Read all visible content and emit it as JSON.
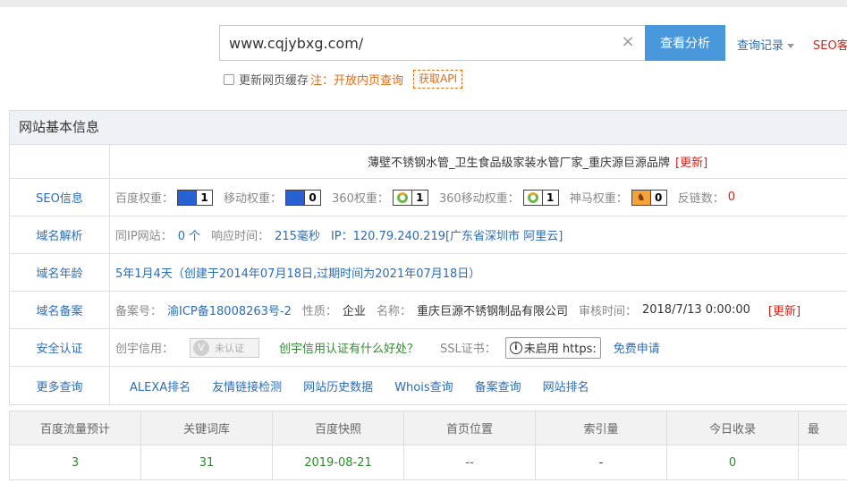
{
  "search": {
    "value": "www.cqjybxg.com/",
    "button": "查看分析",
    "history": "查询记录",
    "seo_link": "SEO客"
  },
  "cache": {
    "label": "更新网页缓存",
    "note": "注：开放内页查询",
    "api_button": "获取API"
  },
  "panel": {
    "title": "网站基本信息",
    "site_title": "薄壁不锈钢水管_卫生食品级家装水管厂家_重庆源巨源品牌",
    "site_title_update": "[更新]",
    "seo": {
      "label": "SEO信息",
      "baidu_label": "百度权重：",
      "baidu_val": "1",
      "mobile_label": "移动权重：",
      "mobile_val": "0",
      "s360_label": "360权重：",
      "s360_val": "1",
      "s360m_label": "360移动权重：",
      "s360m_val": "1",
      "shenma_label": "神马权重：",
      "shenma_val": "0",
      "backlinks_label": "反链数：",
      "backlinks_val": "0"
    },
    "dns": {
      "label": "域名解析",
      "sameip_label": "同IP网站：",
      "sameip_val": "0 个",
      "resp_label": "响应时间：",
      "resp_val": "215毫秒",
      "ip_text": "IP：120.79.240.219[广东省深圳市 阿里云]"
    },
    "age": {
      "label": "域名年龄",
      "text": "5年1月4天（创建于2014年07月18日,过期时间为2021年07月18日）"
    },
    "icp": {
      "label": "域名备案",
      "no_label": "备案号：",
      "no_val": "渝ICP备18008263号-2",
      "nature_label": "性质：",
      "nature_val": "企业",
      "name_label": "名称：",
      "name_val": "重庆巨源不锈钢制品有限公司",
      "time_label": "审核时间：",
      "time_val": "2018/7/13 0:00:00",
      "update": "[更新]"
    },
    "security": {
      "label": "安全认证",
      "credit_label": "创宇信用：",
      "cert_text": "未认证",
      "credit_link": "创宇信用认证有什么好处？",
      "ssl_label": "SSL证书：",
      "ssl_box": "未启用 https:",
      "ssl_apply": "免费申请"
    },
    "more": {
      "label": "更多查询",
      "links": [
        "ALEXA排名",
        "友情链接检测",
        "网站历史数据",
        "Whois查询",
        "备案查询",
        "网站排名"
      ]
    }
  },
  "stats": {
    "headers": [
      "百度流量预计",
      "关键词库",
      "百度快照",
      "首页位置",
      "索引量",
      "今日收录",
      "最"
    ],
    "values": [
      "3",
      "31",
      "2019-08-21",
      "--",
      "-",
      "0",
      ""
    ]
  },
  "colors": {
    "accent": "#4a98dc",
    "link": "#2b6cb5",
    "red": "#d0241b",
    "green": "#2e8b2e",
    "orange": "#e36a14"
  }
}
